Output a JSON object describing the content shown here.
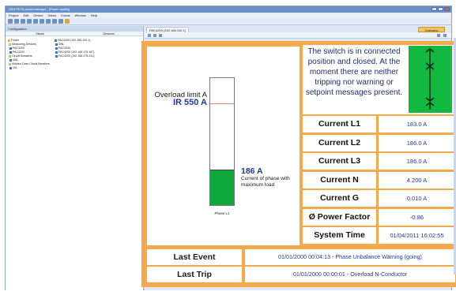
{
  "window": {
    "title": "SENTRON powermanager - [Power quality]",
    "menu": [
      "Project",
      "Edit",
      "Device",
      "Views",
      "Extras",
      "Window",
      "Help"
    ]
  },
  "left_panel": {
    "title": "Configuration",
    "col_headers": [
      "Views",
      "Devices"
    ],
    "tree": [
      "Folder",
      "Measuring Devices",
      "PAC3200",
      "PAC4200",
      "Circuit Breakers",
      "3WL",
      "Molded Case Circuit Breakers",
      "3VL"
    ],
    "tree2": [
      "PAC4200 (192.168.100.1)",
      "3WL",
      "PAC3200",
      "PAC4200 (192.168.175.187)",
      "PAC4200 (192.168.175.241)"
    ]
  },
  "right_area": {
    "tab_label": "PAC4200 (192.168.100.1)",
    "tab_active": "Overview"
  },
  "overload": {
    "label": "Overload limit A",
    "ir_value": "IR 550 A",
    "limit_fraction": 0.2,
    "fill_fraction": 0.28
  },
  "phase": {
    "caption": "Phase L1",
    "current_value": "186 A",
    "current_desc": "Current of phase with maximum load"
  },
  "status": {
    "text": "The switch is in connected position and closed. At the moment there are neither tripping nor warning or setpoint messages present.",
    "icon": "switch-closed-icon",
    "icon_color": "#11b940"
  },
  "measurements": [
    {
      "label": "Current L1",
      "value": "183.0 A"
    },
    {
      "label": "Current L2",
      "value": "186.0 A"
    },
    {
      "label": "Current L3",
      "value": "186.0 A"
    },
    {
      "label": "Current N",
      "value": "4.200 A"
    },
    {
      "label": "Current G",
      "value": "0.010 A"
    },
    {
      "label": "Ø Power Factor",
      "value": "-0.86"
    },
    {
      "label": "System Time",
      "value": "01/04/2011 16:02:55"
    }
  ],
  "events": [
    {
      "label": "Last Event",
      "value": "01/01/2000 00:04:13  -  Phase Unbalance Warning (going)"
    },
    {
      "label": "Last Trip",
      "value": "01/01/2000 00:00:01  -  Overload N-Conductor"
    }
  ],
  "colors": {
    "frame": "#f5a94a",
    "accent_text": "#1f3a8a",
    "bar_fill": "#0ea83c",
    "limit_line": "#e8807a"
  }
}
